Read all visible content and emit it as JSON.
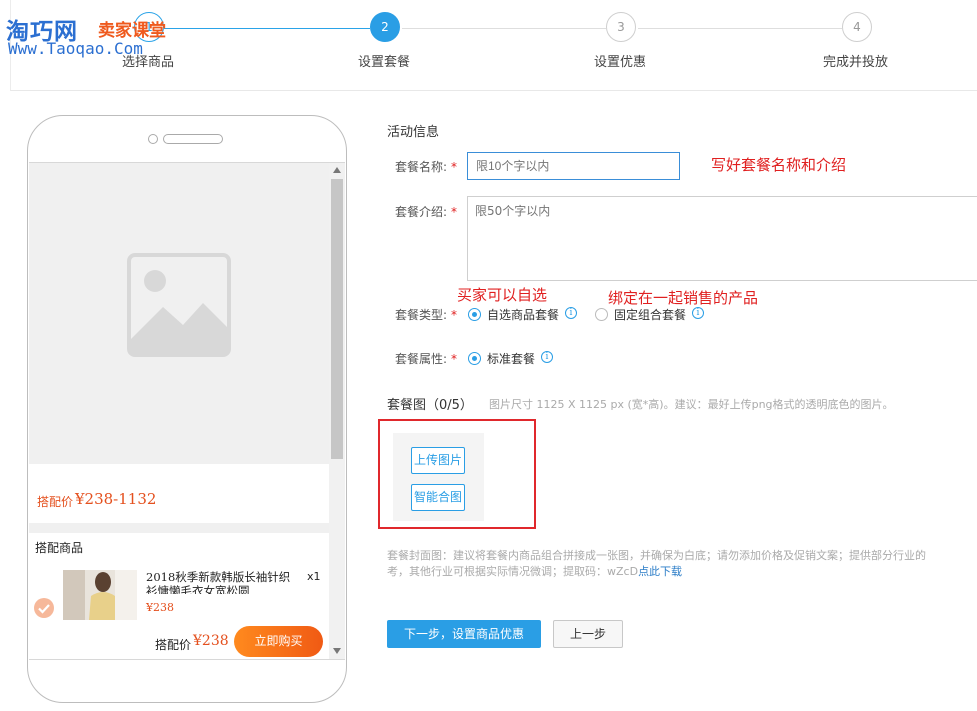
{
  "logo": {
    "cn": "淘巧网",
    "sub": "卖家课堂",
    "url": "Www.Taoqao.Com"
  },
  "steps": [
    {
      "num": "1",
      "label": "选择商品"
    },
    {
      "num": "2",
      "label": "设置套餐"
    },
    {
      "num": "3",
      "label": "设置优惠"
    },
    {
      "num": "4",
      "label": "完成并投放"
    }
  ],
  "preview": {
    "price_label": "搭配价",
    "price_value": "¥238-1132",
    "section_title": "搭配商品",
    "item": {
      "title": "2018秋季新款韩版长袖针织衫慵懒毛衣女宽松圆",
      "price": "¥238",
      "qty": "x1"
    },
    "bottom_price_label": "搭配价",
    "bottom_price_value": "¥238",
    "buy_button": "立即购买"
  },
  "form": {
    "section_title": "活动信息",
    "name": {
      "label": "套餐名称:",
      "placeholder": "限10个字以内"
    },
    "intro": {
      "label": "套餐介绍:",
      "placeholder": "限50个字以内"
    },
    "type": {
      "label": "套餐类型:",
      "options": [
        "自选商品套餐",
        "固定组合套餐"
      ],
      "selected": "自选商品套餐"
    },
    "attr": {
      "label": "套餐属性:",
      "options": [
        "标准套餐"
      ],
      "selected": "标准套餐"
    },
    "required_mark": "*",
    "info_glyph": "i",
    "image_section": {
      "title": "套餐图（0/5）",
      "hint": "图片尺寸 1125 X 1125 px (宽*高)。建议：最好上传png格式的透明底色的图片。",
      "upload_button": "上传图片",
      "smart_button": "智能合图"
    },
    "cover_hint_line1": "套餐封面图：建议将套餐内商品组合拼接成一张图，并确保为白底；请勿添加价格及促销文案；提供部分行业的",
    "cover_hint_line2": "考，其他行业可根据实际情况微调；提取码：wZcD",
    "cover_hint_link": "点此下载",
    "next_button": "下一步，设置商品优惠",
    "prev_button": "上一步"
  },
  "annotations": {
    "name_intro": "写好套餐名称和介绍",
    "optional": "买家可以自选",
    "bundle": "绑定在一起销售的产品"
  },
  "colors": {
    "primary": "#2a9ee5",
    "annotation": "#e02020",
    "price": "#e4501e",
    "buy": "#f26f16",
    "highlight_box": "#e0282c"
  }
}
